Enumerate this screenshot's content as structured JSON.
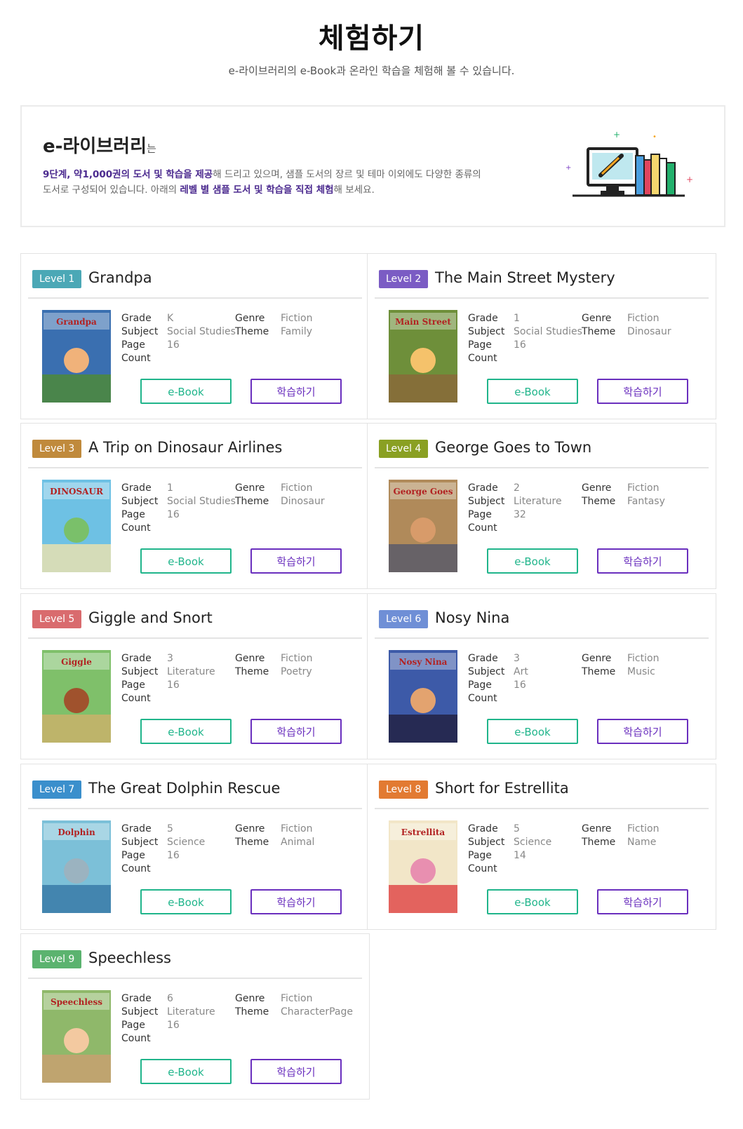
{
  "header": {
    "title": "체험하기",
    "subtitle": "e-라이브러리의 e-Book과 온라인 학습을 체험해 볼 수 있습니다."
  },
  "intro": {
    "heading": "e-라이브러리",
    "heading_suffix": "는",
    "line1_em": "9단계, 약1,000권의 도서 및 학습을 제공",
    "line1_rest": "해 드리고 있으며, 샘플 도서의 장르 및 테마 이외에도 다양한 종류의",
    "line2_start": "도서로 구성되어 있습니다. 아래의 ",
    "line2_em": "레벨 별 샘플 도서 및 학습을 직접 체험",
    "line2_end": "해 보세요."
  },
  "labels": {
    "grade": "Grade",
    "subject": "Subject",
    "page": "Page",
    "count": "Count",
    "genre": "Genre",
    "theme": "Theme",
    "ebook_button": "e-Book",
    "study_button": "학습하기"
  },
  "books": [
    {
      "level": "Level 1",
      "title": "Grandpa",
      "grade": "K",
      "subject": "Social Studies",
      "pages": "16",
      "genre": "Fiction",
      "theme": "Family",
      "cover_text": "Grandpa",
      "color": "#4ba8b6"
    },
    {
      "level": "Level 2",
      "title": "The Main Street Mystery",
      "grade": "1",
      "subject": "Social Studies",
      "pages": "16",
      "genre": "Fiction",
      "theme": "Dinosaur",
      "cover_text": "Main Street",
      "color": "#7b5cc4"
    },
    {
      "level": "Level 3",
      "title": "A Trip on Dinosaur Airlines",
      "grade": "1",
      "subject": "Social Studies",
      "pages": "16",
      "genre": "Fiction",
      "theme": "Dinosaur",
      "cover_text": "DINOSAUR",
      "color": "#c08a3c"
    },
    {
      "level": "Level 4",
      "title": "George Goes to Town",
      "grade": "2",
      "subject": "Literature",
      "pages": "32",
      "genre": "Fiction",
      "theme": "Fantasy",
      "cover_text": "George Goes",
      "color": "#8aa023"
    },
    {
      "level": "Level 5",
      "title": "Giggle and Snort",
      "grade": "3",
      "subject": "Literature",
      "pages": "16",
      "genre": "Fiction",
      "theme": "Poetry",
      "cover_text": "Giggle",
      "color": "#d96b6e"
    },
    {
      "level": "Level 6",
      "title": "Nosy Nina",
      "grade": "3",
      "subject": "Art",
      "pages": "16",
      "genre": "Fiction",
      "theme": "Music",
      "cover_text": "Nosy Nina",
      "color": "#6f8fd6"
    },
    {
      "level": "Level 7",
      "title": "The Great Dolphin Rescue",
      "grade": "5",
      "subject": "Science",
      "pages": "16",
      "genre": "Fiction",
      "theme": "Animal",
      "cover_text": "Dolphin",
      "color": "#3b8fcc"
    },
    {
      "level": "Level 8",
      "title": "Short for Estrellita",
      "grade": "5",
      "subject": "Science",
      "pages": "14",
      "genre": "Fiction",
      "theme": "Name",
      "cover_text": "Estrellita",
      "color": "#e27a32"
    },
    {
      "level": "Level 9",
      "title": "Speechless",
      "grade": "6",
      "subject": "Literature",
      "pages": "16",
      "genre": "Fiction",
      "theme": "CharacterPage",
      "cover_text": "Speechless",
      "color": "#5bb36f"
    }
  ],
  "colors": {
    "ebook_accent": "#20b58b",
    "study_accent": "#6a2fbe",
    "highlight_text": "#4b2a8f"
  }
}
